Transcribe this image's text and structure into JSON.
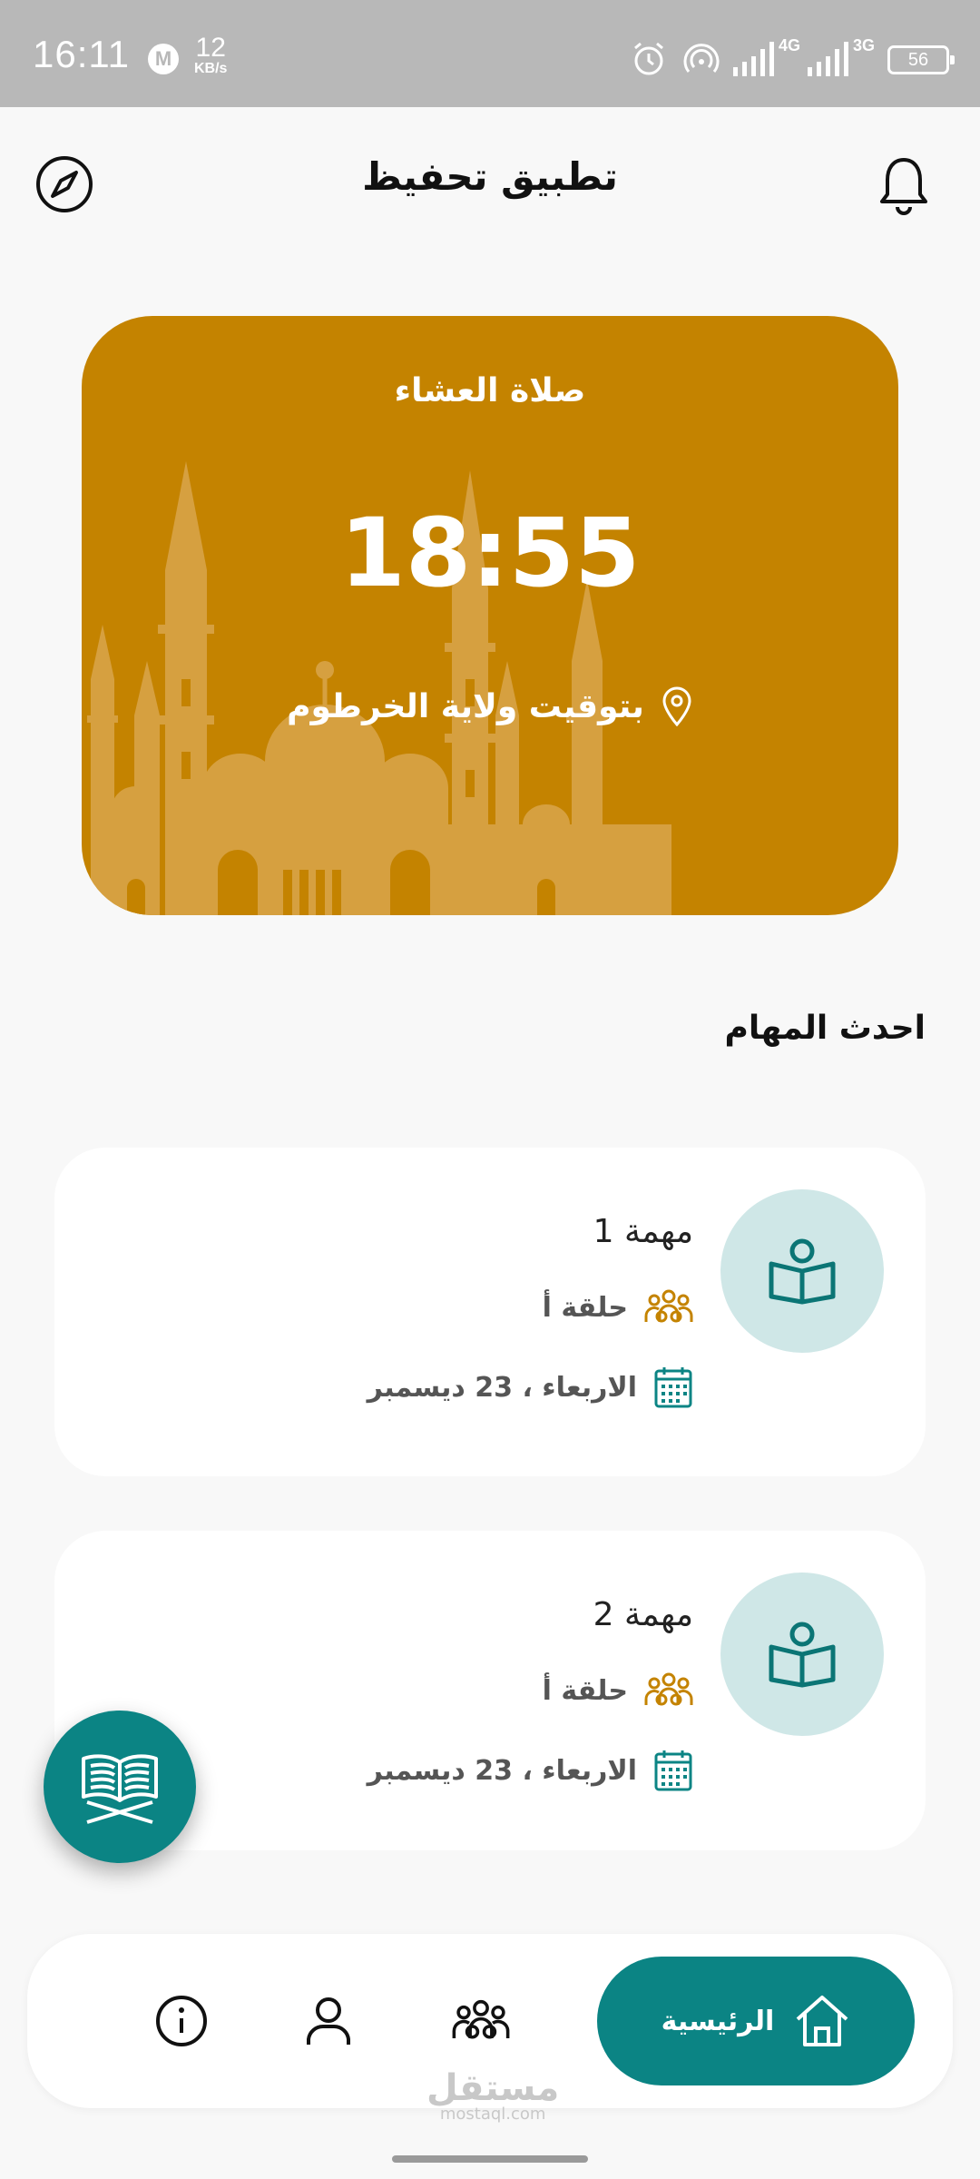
{
  "status_bar": {
    "time": "16:11",
    "notification_icon": "M",
    "net_speed_value": "12",
    "net_speed_unit": "KB/s",
    "network_4g": "4G",
    "network_3g": "3G",
    "battery": "56"
  },
  "header": {
    "title": "تطبيق تحفيظ"
  },
  "prayer_card": {
    "prayer_name": "صلاة العشاء",
    "time": "18:55",
    "location": "بتوقيت ولاية الخرطوم"
  },
  "tasks_section": {
    "title": "احدث المهام"
  },
  "tasks": [
    {
      "title": "مهمة 1",
      "group": "حلقة أ",
      "date": "الاربعاء ، 23 ديسمبر"
    },
    {
      "title": "مهمة 2",
      "group": "حلقة أ",
      "date": "الاربعاء ، 23 ديسمبر"
    }
  ],
  "bottom_nav": {
    "home_label": "الرئيسية"
  },
  "watermark": {
    "arabic": "مستقل",
    "latin": "mostaql.com"
  },
  "colors": {
    "primary_teal": "#0b8484",
    "card_gold": "#c48300",
    "icon_gold": "#c48300",
    "light_teal": "#cfe7e7"
  }
}
